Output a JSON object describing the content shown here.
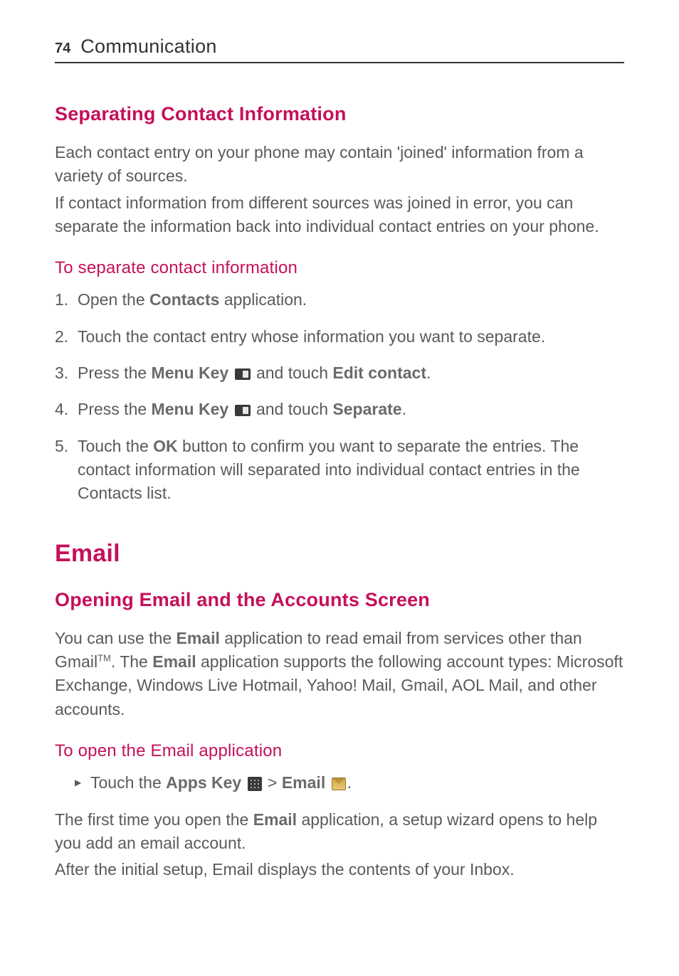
{
  "header": {
    "page_number": "74",
    "section": "Communication"
  },
  "section1": {
    "title": "Separating Contact Information",
    "para1": "Each contact entry on your phone may contain 'joined' information from a variety of sources.",
    "para2": "If contact information from different sources was joined in error, you can separate the information back into individual contact entries on your phone.",
    "sub1_title": "To separate contact information",
    "steps": {
      "s1_a": "Open the ",
      "s1_b": "Contacts",
      "s1_c": " application.",
      "s2": "Touch the contact entry whose information you want to separate.",
      "s3_a": "Press the ",
      "s3_b": "Menu Key",
      "s3_c": " and touch ",
      "s3_d": "Edit contact",
      "s3_e": ".",
      "s4_a": "Press the ",
      "s4_b": "Menu Key",
      "s4_c": " and touch ",
      "s4_d": "Separate",
      "s4_e": ".",
      "s5_a": "Touch the ",
      "s5_b": "OK",
      "s5_c": " button to confirm you want to separate the entries. The contact information will separated into individual contact entries in the Contacts list."
    }
  },
  "section2": {
    "title": "Email",
    "sub1_title": "Opening Email and the Accounts Screen",
    "para1_a": "You can use the ",
    "para1_b": "Email",
    "para1_c": " application to read email from services other than Gmail",
    "para1_tm": "TM",
    "para1_d": ". The ",
    "para1_e": "Email",
    "para1_f": " application supports the following account types: Microsoft Exchange, Windows Live Hotmail, Yahoo! Mail, Gmail, AOL Mail, and other accounts.",
    "sub2_title": "To open the Email application",
    "bullet_a": "Touch the ",
    "bullet_b": "Apps Key",
    "bullet_c": " > ",
    "bullet_d": "Email",
    "bullet_e": ".",
    "para2_a": "The first time you open the ",
    "para2_b": "Email",
    "para2_c": " application, a setup wizard opens to help you add an email account.",
    "para3": "After the initial setup, Email displays the contents of your Inbox."
  }
}
